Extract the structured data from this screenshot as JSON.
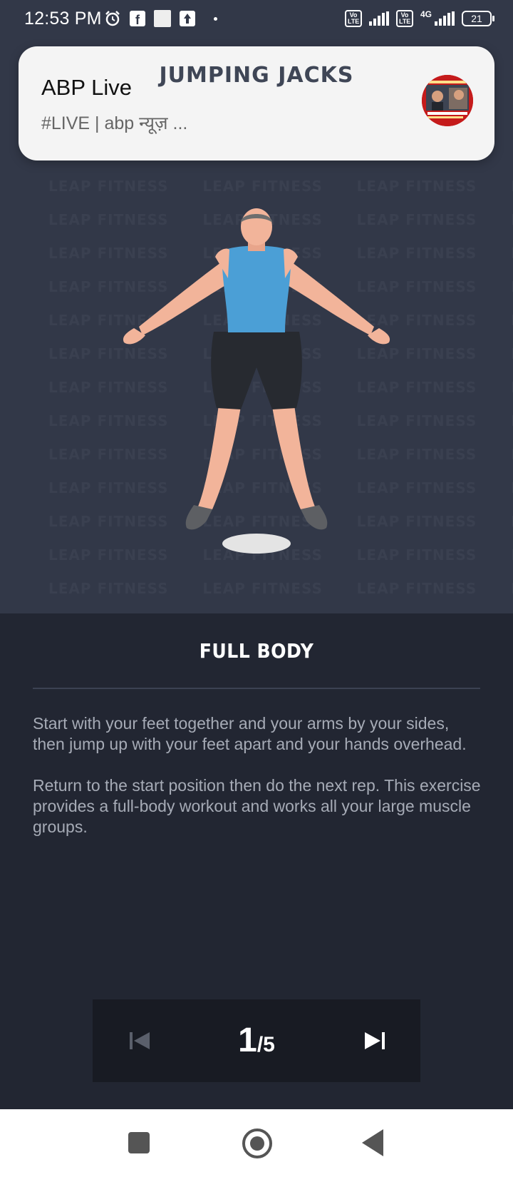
{
  "status_bar": {
    "time": "12:53 PM",
    "left_icons": [
      "alarm-icon",
      "facebook-icon",
      "square-icon",
      "upload-icon",
      "dot-icon"
    ],
    "volte1": "Vo LTE",
    "volte2": "Vo LTE",
    "network": "4G",
    "battery": "21"
  },
  "header": {
    "title": "JUMPING JACKS"
  },
  "watermark_text": "LEAP FITNESS",
  "notification": {
    "app": "ABP Live",
    "text": "#LIVE | abp न्यूज़ ..."
  },
  "content": {
    "section_title": "FULL BODY",
    "paragraphs": [
      "Start with your feet together and your arms by your sides, then jump up with your feet apart and your hands overhead.",
      "Return to the start position then do the next rep. This exercise provides a full-body workout and works all your large muscle groups."
    ]
  },
  "controls": {
    "current": "1",
    "total": "/5"
  },
  "colors": {
    "top_bg": "#323848",
    "content_bg": "#222632",
    "controls_bg": "#181b23",
    "shirt": "#4b9fd6",
    "skin": "#f2b49a"
  }
}
